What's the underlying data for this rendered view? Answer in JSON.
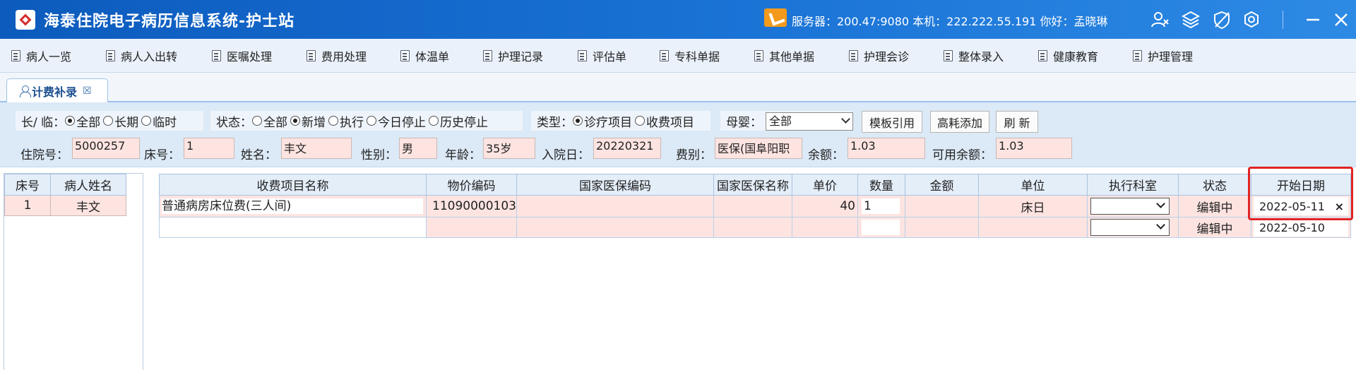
{
  "app": {
    "title": "海泰住院电子病历信息系统-护士站",
    "server_info": "服务器：200.47:9080 本机：222.222.55.191 你好：孟晓琳",
    "accent": "#1a73d6",
    "icons": [
      "user-switch-icon",
      "layers-icon",
      "shield-off-icon",
      "settings-icon",
      "minimize-icon"
    ]
  },
  "menu": [
    "病人一览",
    "病人入出转",
    "医嘱处理",
    "费用处理",
    "体温单",
    "护理记录",
    "评估单",
    "专科单据",
    "其他单据",
    "护理会诊",
    "整体录入",
    "健康教育",
    "护理管理"
  ],
  "tab": {
    "label": "计费补录",
    "close": "☒"
  },
  "filters": {
    "long_temp": {
      "label": "长/ 临：",
      "options": [
        "全部",
        "长期",
        "临时"
      ],
      "selected": 0
    },
    "status": {
      "label": "状态：",
      "options": [
        "全部",
        "新增",
        "执行",
        "今日停止",
        "历史停止"
      ],
      "selected": 1
    },
    "type": {
      "label": "类型：",
      "options": [
        "诊疗项目",
        "收费项目"
      ],
      "selected": 0
    },
    "mother_baby": {
      "label": "母婴：",
      "value": "全部"
    },
    "buttons": {
      "template": "模板引用",
      "high_cost": "高耗添加",
      "refresh": "刷 新"
    }
  },
  "patient": {
    "admission_no_label": "住院号：",
    "admission_no": "5000257",
    "bed_label": "床号：",
    "bed": "1",
    "name_label": "姓名：",
    "name": "丰文",
    "sex_label": "性别：",
    "sex": "男",
    "age_label": "年龄：",
    "age": "35岁",
    "admit_date_label": "入院日：",
    "admit_date": "20220321",
    "fee_type_label": "费别：",
    "fee_type": "医保(国阜阳职",
    "balance_label": "余额：",
    "balance": "1.03",
    "available_label": "可用余额：",
    "available": "1.03"
  },
  "bed_list": {
    "headers": [
      "床号",
      "病人姓名"
    ],
    "rows": [
      {
        "bed": "1",
        "name": "丰文"
      }
    ]
  },
  "grid": {
    "headers": [
      "收费项目名称",
      "物价编码",
      "国家医保编码",
      "国家医保名称",
      "单价",
      "数量",
      "金额",
      "单位",
      "执行科室",
      "状态",
      "开始日期"
    ],
    "rows": [
      {
        "name": "普通病房床位费(三人间)",
        "price_code": "11090000103",
        "nhs_code": "",
        "nhs_name": "",
        "unit_price": "40",
        "qty": "1",
        "amount": "",
        "unit": "床日",
        "dept": "",
        "status": "编辑中",
        "start_date": "2022-05-11",
        "clear": "×"
      },
      {
        "name": "",
        "price_code": "",
        "nhs_code": "",
        "nhs_name": "",
        "unit_price": "",
        "qty": "",
        "amount": "",
        "unit": "",
        "dept": "",
        "status": "编辑中",
        "start_date": "2022-05-10"
      }
    ]
  },
  "highlight_color": "#e02424"
}
